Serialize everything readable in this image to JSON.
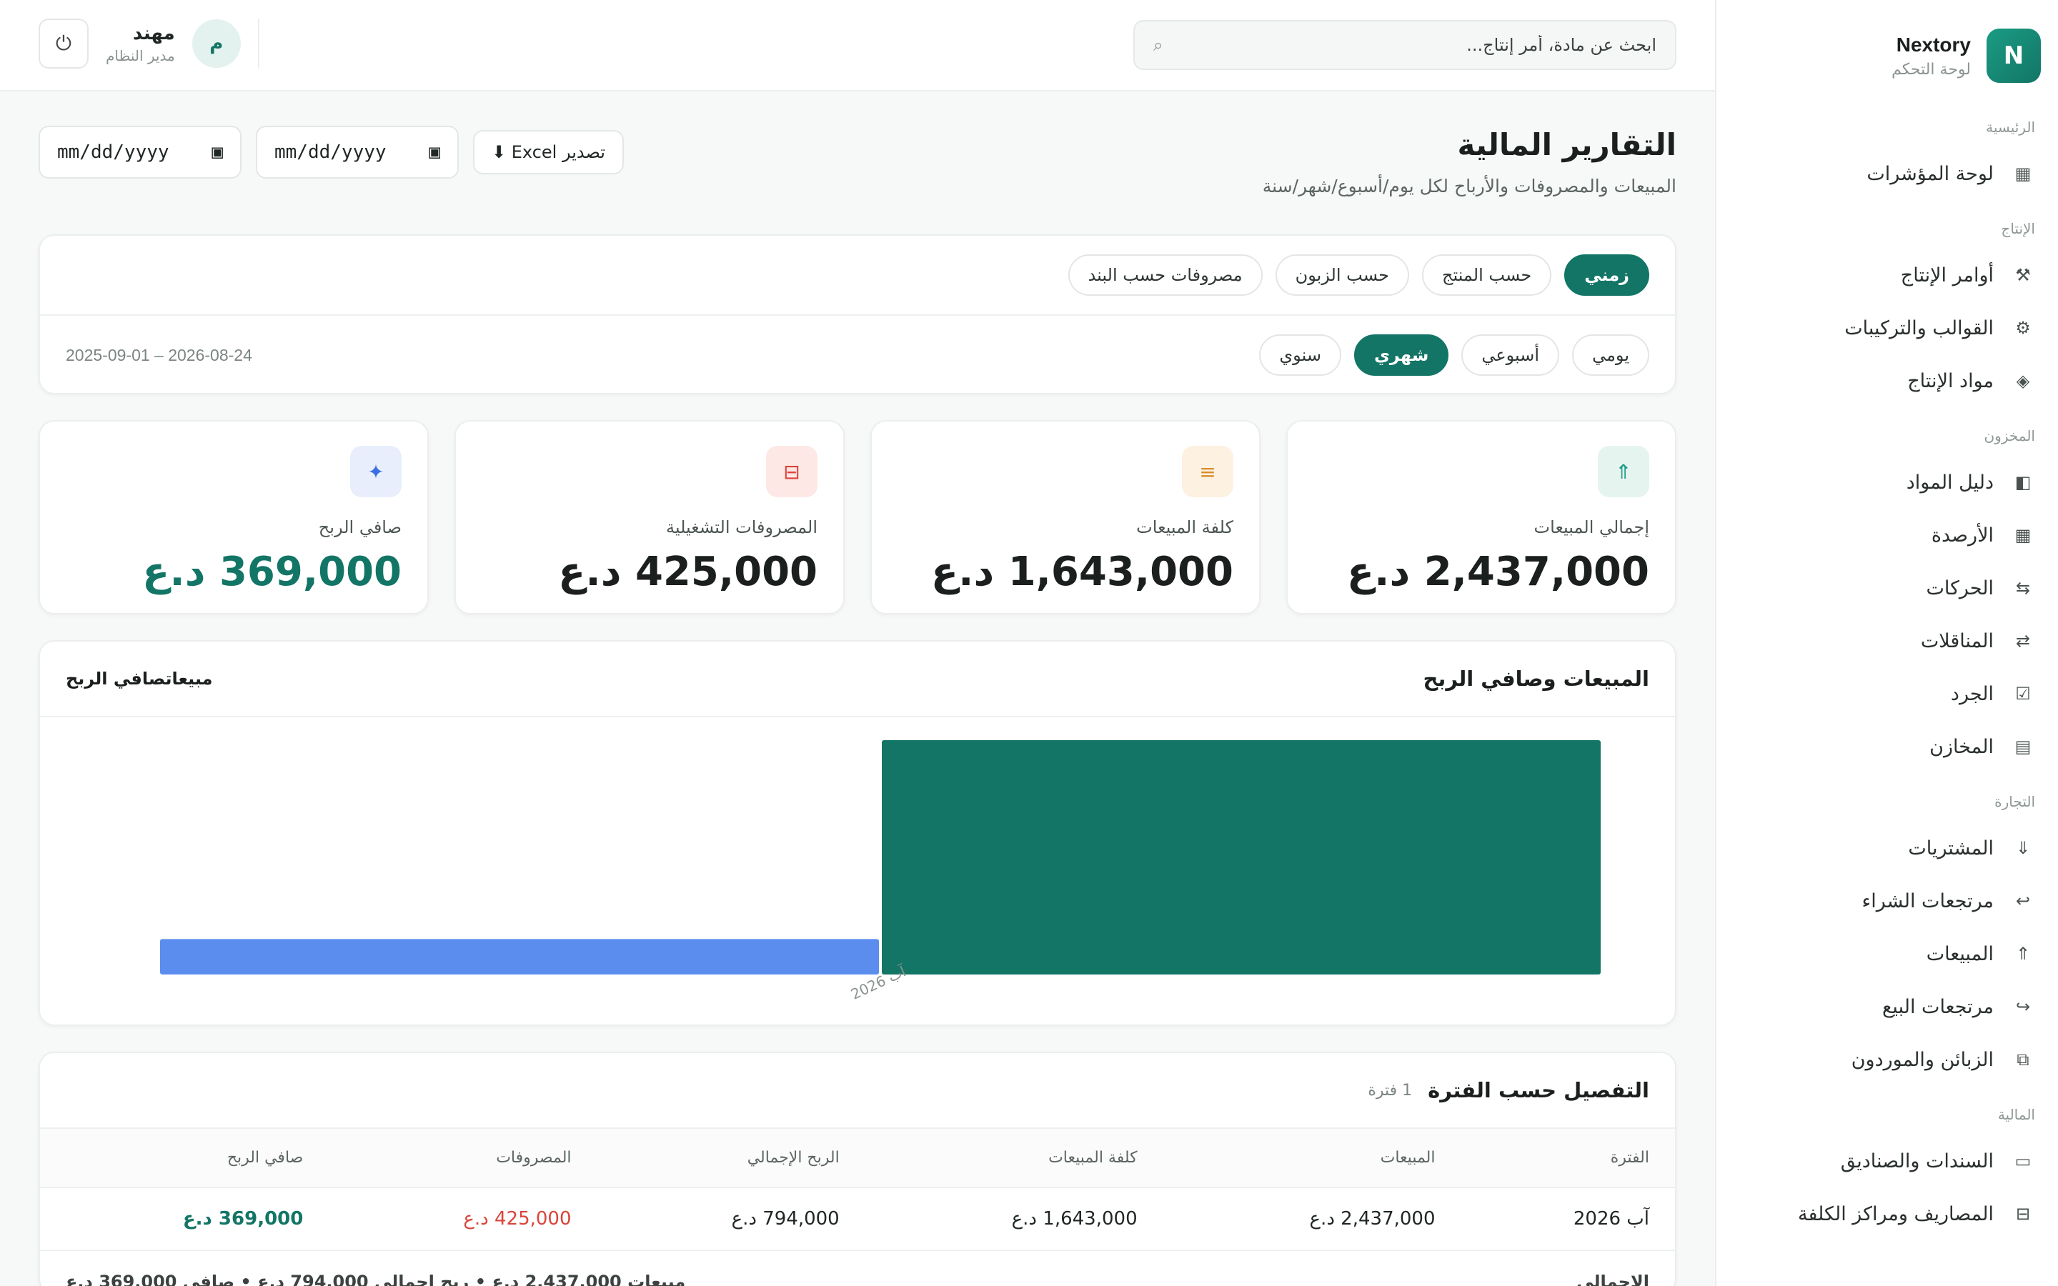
{
  "brand": {
    "logo_letter": "N",
    "name": "Nextory",
    "subtitle": "لوحة التحكم"
  },
  "sidebar": {
    "sections": [
      {
        "title": "الرئيسية",
        "items": [
          {
            "label": "لوحة المؤشرات",
            "icon": "grid-icon"
          }
        ]
      },
      {
        "title": "الإنتاج",
        "items": [
          {
            "label": "أوامر الإنتاج",
            "icon": "factory-icon"
          },
          {
            "label": "القوالب والتركيبات",
            "icon": "gear-icon"
          },
          {
            "label": "مواد الإنتاج",
            "icon": "diamond-icon"
          }
        ]
      },
      {
        "title": "المخزون",
        "items": [
          {
            "label": "دليل المواد",
            "icon": "book-icon"
          },
          {
            "label": "الأرصدة",
            "icon": "table-icon"
          },
          {
            "label": "الحركات",
            "icon": "movements-icon"
          },
          {
            "label": "المناقلات",
            "icon": "transfer-icon"
          },
          {
            "label": "الجرد",
            "icon": "checkbox-icon"
          },
          {
            "label": "المخازن",
            "icon": "warehouse-icon"
          }
        ]
      },
      {
        "title": "التجارة",
        "items": [
          {
            "label": "المشتريات",
            "icon": "arrow-down-icon"
          },
          {
            "label": "مرتجعات الشراء",
            "icon": "return-icon"
          },
          {
            "label": "المبيعات",
            "icon": "arrow-up-icon"
          },
          {
            "label": "مرتجعات البيع",
            "icon": "redo-icon"
          },
          {
            "label": "الزبائن والموردون",
            "icon": "contacts-icon"
          }
        ]
      },
      {
        "title": "المالية",
        "items": [
          {
            "label": "السندات والصناديق",
            "icon": "cash-icon"
          },
          {
            "label": "المصاريف ومراكز الكلفة",
            "icon": "expenses-icon"
          }
        ]
      }
    ]
  },
  "topbar": {
    "search_placeholder": "ابحث عن مادة، أمر إنتاج...",
    "user_name": "مهند",
    "user_role": "مدير النظام",
    "avatar_letter": "م"
  },
  "page": {
    "title": "التقارير المالية",
    "subtitle": "المبيعات والمصروفات والأرباح لكل يوم/أسبوع/شهر/سنة",
    "date_placeholder": "mm/dd/yyyy",
    "export_label": "تصدير Excel ⬇"
  },
  "filters": {
    "group_tabs": [
      {
        "label": "زمني",
        "active": true
      },
      {
        "label": "حسب المنتج",
        "active": false
      },
      {
        "label": "حسب الزبون",
        "active": false
      },
      {
        "label": "مصروفات حسب البند",
        "active": false
      }
    ],
    "period_tabs": [
      {
        "label": "يومي",
        "active": false
      },
      {
        "label": "أسبوعي",
        "active": false
      },
      {
        "label": "شهري",
        "active": true
      },
      {
        "label": "سنوي",
        "active": false
      }
    ],
    "range": "2025-09-01 – 2026-08-24"
  },
  "kpis": [
    {
      "label": "إجمالي المبيعات",
      "value": "2,437,000 د.ع",
      "icon": "arrow-up-icon",
      "icon_glyph": "⇑",
      "icon_color": "#1a9c83",
      "icon_bg": "#e6f4f0",
      "highlight": false
    },
    {
      "label": "كلفة المبيعات",
      "value": "1,643,000 د.ع",
      "icon": "list-icon",
      "icon_glyph": "≡",
      "icon_color": "#d98c2b",
      "icon_bg": "#fdf1e1",
      "highlight": false
    },
    {
      "label": "المصروفات التشغيلية",
      "value": "425,000 د.ع",
      "icon": "receipt-icon",
      "icon_glyph": "⊟",
      "icon_color": "#d9453a",
      "icon_bg": "#fde8e6",
      "highlight": false
    },
    {
      "label": "صافي الربح",
      "value": "369,000 د.ع",
      "icon": "sparkle-icon",
      "icon_glyph": "✦",
      "icon_color": "#3b6fe0",
      "icon_bg": "#e8eefc",
      "highlight": true
    }
  ],
  "chart": {
    "title": "المبيعات وصافي الربح",
    "legend_text": "مبيعاتصافي الربح",
    "colors": {
      "sales": "#137566",
      "profit": "#5b8def"
    }
  },
  "chart_data": {
    "type": "bar",
    "categories": [
      "آب 2026"
    ],
    "series": [
      {
        "name": "مبيعات",
        "values": [
          2437000
        ]
      },
      {
        "name": "صافي الربح",
        "values": [
          369000
        ]
      }
    ],
    "ylim": [
      0,
      2437000
    ]
  },
  "table": {
    "title": "التفصيل حسب الفترة",
    "count": "1 فترة",
    "headers": [
      "الفترة",
      "المبيعات",
      "كلفة المبيعات",
      "الربح الإجمالي",
      "المصروفات",
      "صافي الربح"
    ],
    "rows": [
      [
        "آب 2026",
        "2,437,000 د.ع",
        "1,643,000 د.ع",
        "794,000 د.ع",
        "425,000 د.ع",
        "369,000 د.ع"
      ]
    ],
    "total_label": "الإجمالي",
    "total_text": "مبيعات 2,437,000 د.ع • ربح إجمالي 794,000 د.ع • صافي 369,000 د.ع"
  }
}
